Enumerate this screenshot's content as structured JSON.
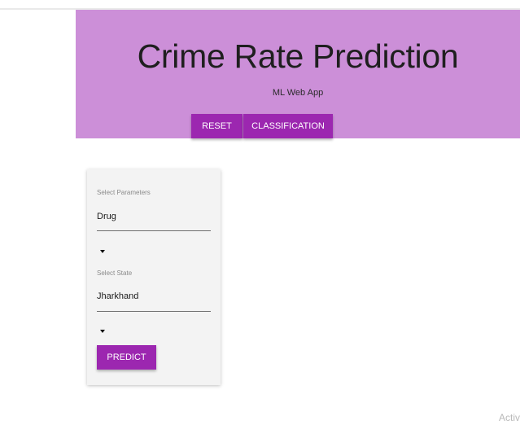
{
  "header": {
    "title": "Crime Rate Prediction",
    "subtitle": "ML Web App",
    "buttons": {
      "reset_label": "RESET",
      "classification_label": "CLASSIFICATION"
    }
  },
  "form": {
    "parameters": {
      "label": "Select Parameters",
      "value": "Drug"
    },
    "state": {
      "label": "Select State",
      "value": "Jharkhand"
    },
    "predict_label": "PREDICT"
  },
  "watermark": "Activ",
  "colors": {
    "header_bg": "#cc8fd8",
    "accent": "#9c27b0",
    "card_bg": "#f3f3f3"
  },
  "icons": {
    "dropdown": "caret-down-icon"
  }
}
